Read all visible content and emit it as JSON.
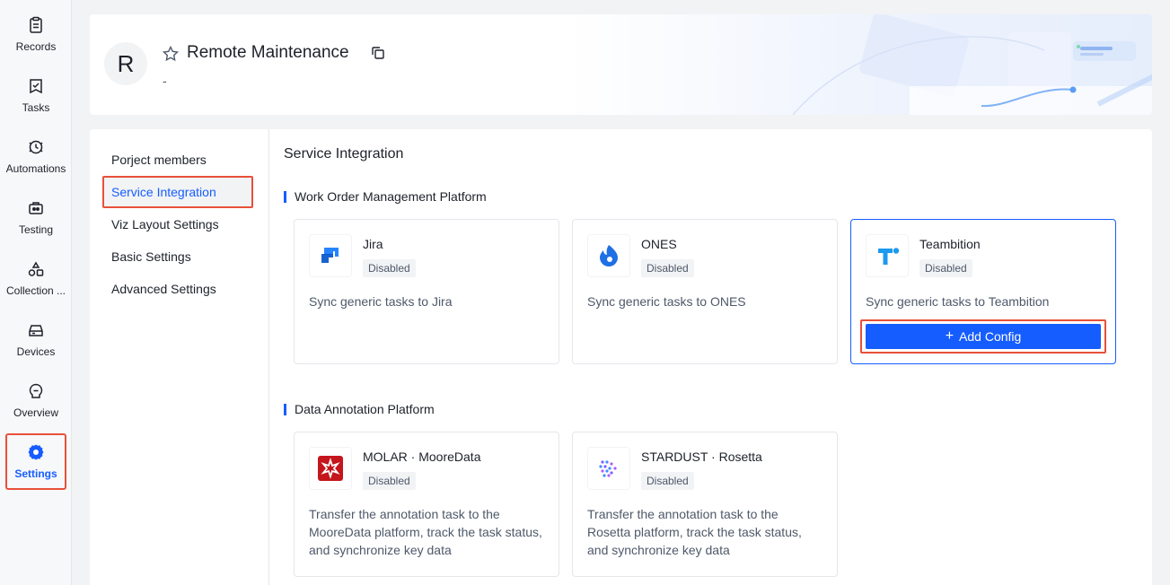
{
  "rail": {
    "items": [
      {
        "label": "Records",
        "icon": "clipboard-icon"
      },
      {
        "label": "Tasks",
        "icon": "task-flag-icon"
      },
      {
        "label": "Automations",
        "icon": "automation-icon"
      },
      {
        "label": "Testing",
        "icon": "testing-icon"
      },
      {
        "label": "Collection ...",
        "icon": "collection-icon"
      },
      {
        "label": "Devices",
        "icon": "device-icon"
      },
      {
        "label": "Overview",
        "icon": "overview-icon"
      },
      {
        "label": "Settings",
        "icon": "gear-icon"
      }
    ],
    "active": "Settings"
  },
  "project": {
    "avatar_letter": "R",
    "title": "Remote Maintenance",
    "subtitle": "-"
  },
  "settings_nav": {
    "items": [
      {
        "label": "Porject members"
      },
      {
        "label": "Service Integration"
      },
      {
        "label": "Viz Layout Settings"
      },
      {
        "label": "Basic Settings"
      },
      {
        "label": "Advanced Settings"
      }
    ],
    "active": "Service Integration"
  },
  "content": {
    "title": "Service Integration",
    "groups": [
      {
        "title": "Work Order Management Platform",
        "cards": [
          {
            "name": "Jira",
            "status": "Disabled",
            "description": "Sync generic tasks to Jira"
          },
          {
            "name": "ONES",
            "status": "Disabled",
            "description": "Sync generic tasks to ONES"
          },
          {
            "name": "Teambition",
            "status": "Disabled",
            "description": "Sync generic tasks to Teambition",
            "button": "Add Config"
          }
        ]
      },
      {
        "title": "Data Annotation Platform",
        "cards": [
          {
            "name": "MOLAR · MooreData",
            "status": "Disabled",
            "description": "Transfer the annotation task to the MooreData platform, track the task status, and synchronize key data"
          },
          {
            "name": "STARDUST · Rosetta",
            "status": "Disabled",
            "description": "Transfer the annotation task to the Rosetta platform, track the task status, and synchronize key data"
          }
        ]
      }
    ]
  },
  "colors": {
    "accent": "#165dff",
    "highlight": "#e8503a",
    "molar_red": "#c4161c"
  }
}
